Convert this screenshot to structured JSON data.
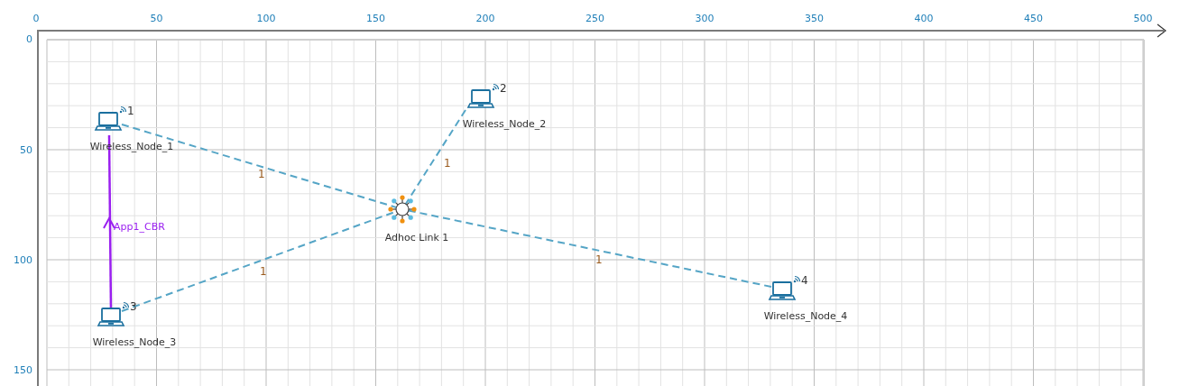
{
  "x_axis": {
    "ticks": [
      "0",
      "50",
      "100",
      "150",
      "200",
      "250",
      "300",
      "350",
      "400",
      "450",
      "500"
    ]
  },
  "y_axis": {
    "ticks": [
      "0",
      "50",
      "100",
      "150"
    ]
  },
  "nodes": [
    {
      "name": "Wireless_Node_1",
      "number": "1"
    },
    {
      "name": "Wireless_Node_2",
      "number": "2"
    },
    {
      "name": "Wireless_Node_3",
      "number": "3"
    },
    {
      "name": "Wireless_Node_4",
      "number": "4"
    }
  ],
  "device": {
    "name": "Adhoc Link 1"
  },
  "links": [
    {
      "label": "1"
    },
    {
      "label": "1"
    },
    {
      "label": "1"
    },
    {
      "label": "1"
    }
  ],
  "applications": [
    {
      "name": "App1_CBR"
    }
  ]
}
